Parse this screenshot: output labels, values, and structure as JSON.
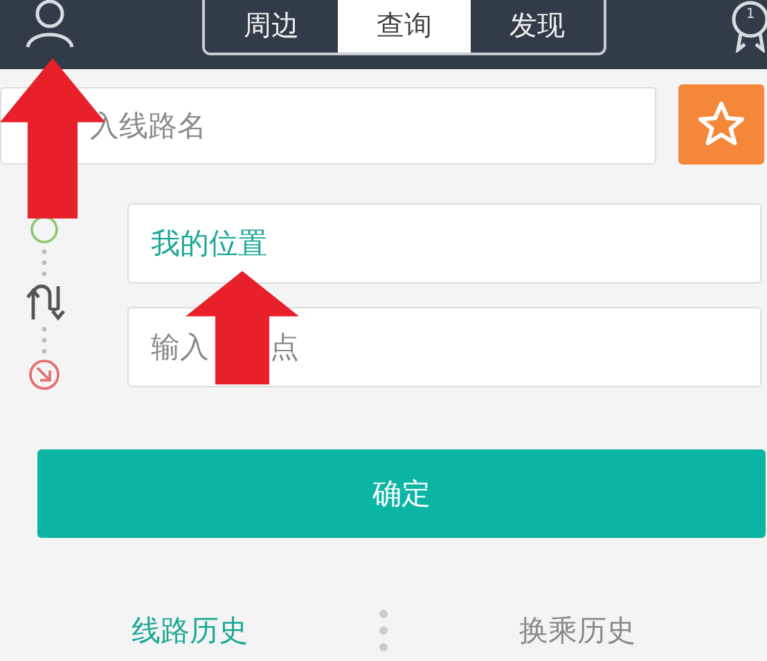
{
  "top_bar": {
    "tabs": [
      {
        "label": "周边",
        "selected": false
      },
      {
        "label": "查询",
        "selected": true
      },
      {
        "label": "发现",
        "selected": false
      }
    ],
    "badge": "1"
  },
  "line_search": {
    "placeholder": "入线路名"
  },
  "route": {
    "start": {
      "value": "我的位置"
    },
    "end": {
      "placeholder_parts": [
        "输入",
        "点"
      ]
    }
  },
  "confirm_button": "确定",
  "history_tabs": [
    {
      "label": "线路历史",
      "selected": true
    },
    {
      "label": "换乘历史",
      "selected": false
    }
  ]
}
